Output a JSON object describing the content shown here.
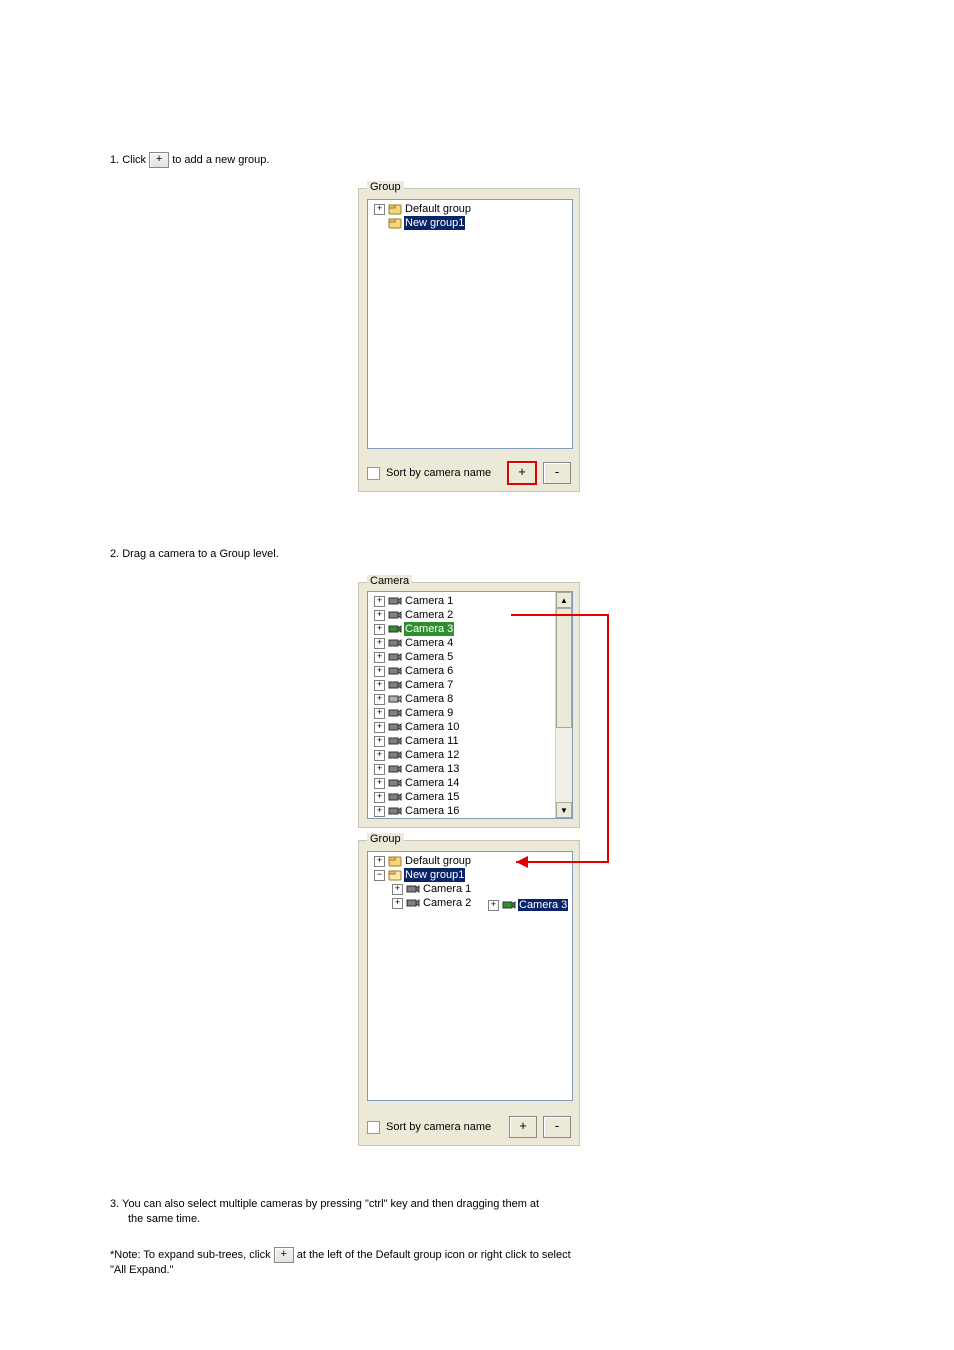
{
  "instructions": {
    "step1_a": "1. Click ",
    "step1_b": " to add a new group.",
    "step2": "2. Drag a camera to a Group level.",
    "step3_a": "3. You can also select multiple cameras by pressing \"ctrl\" key and then dragging them at",
    "step3_b": "the same time.",
    "note": "*Note: To expand sub-trees, click ",
    "note2": " at the left of the Default group icon or right click to select",
    "note3": "\"All Expand.\""
  },
  "panel1": {
    "legend": "Group",
    "tree": [
      {
        "indent": 0,
        "exp": "+",
        "icon": "group",
        "label": "Default group",
        "sel": false
      },
      {
        "indent": 0,
        "exp": "",
        "icon": "group",
        "label": "New group1",
        "sel": true
      }
    ],
    "sort_label": "Sort by camera name",
    "btn_plus": "+",
    "btn_minus": "-"
  },
  "panel2": {
    "camera_legend": "Camera",
    "group_legend": "Group",
    "cameras": [
      {
        "label": "Camera 1",
        "sel": false
      },
      {
        "label": "Camera 2",
        "sel": false
      },
      {
        "label": "Camera 3",
        "sel": true,
        "green": true
      },
      {
        "label": "Camera 4",
        "sel": false
      },
      {
        "label": "Camera 5",
        "sel": false
      },
      {
        "label": "Camera 6",
        "sel": false
      },
      {
        "label": "Camera 7",
        "sel": false
      },
      {
        "label": "Camera 8",
        "sel": false,
        "offline": true
      },
      {
        "label": "Camera 9",
        "sel": false
      },
      {
        "label": "Camera 10",
        "sel": false
      },
      {
        "label": "Camera 11",
        "sel": false
      },
      {
        "label": "Camera 12",
        "sel": false
      },
      {
        "label": "Camera 13",
        "sel": false
      },
      {
        "label": "Camera 14",
        "sel": false
      },
      {
        "label": "Camera 15",
        "sel": false
      },
      {
        "label": "Camera 16",
        "sel": false
      }
    ],
    "group_tree": [
      {
        "indent": 0,
        "exp": "+",
        "icon": "group",
        "label": "Default group",
        "sel": false
      },
      {
        "indent": 0,
        "exp": "-",
        "icon": "group-open",
        "label": "New group1",
        "sel": true
      },
      {
        "indent": 1,
        "exp": "+",
        "icon": "cam",
        "label": "Camera 1",
        "sel": false
      },
      {
        "indent": 1,
        "exp": "+",
        "icon": "cam",
        "label": "Camera 2",
        "sel": false
      }
    ],
    "drag_ghost": {
      "exp": "+",
      "label": "Camera 3"
    },
    "sort_label": "Sort by camera name",
    "btn_plus": "+",
    "btn_minus": "-"
  }
}
